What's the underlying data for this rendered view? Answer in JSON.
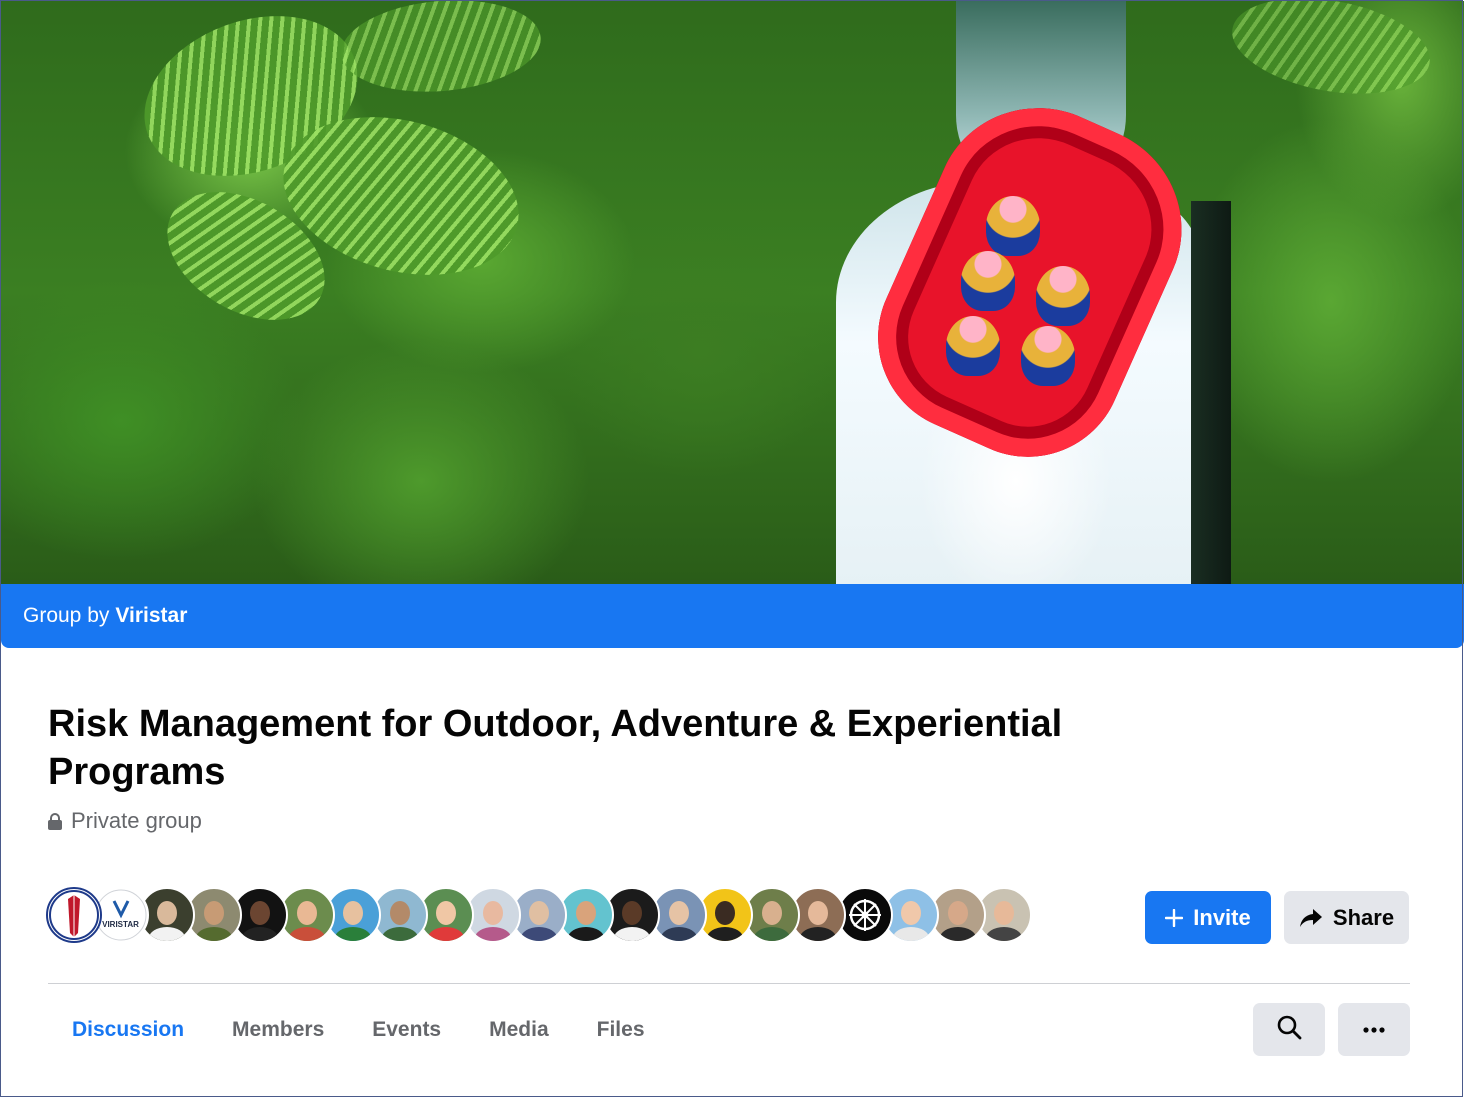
{
  "header": {
    "group_by_prefix": "Group by",
    "group_owner": "Viristar"
  },
  "group": {
    "title": "Risk Management for Outdoor, Adventure & Experiential Programs",
    "privacy": "Private group"
  },
  "members_preview": {
    "avatars": [
      {
        "kind": "logo-kayak",
        "bg": "#ffffff"
      },
      {
        "kind": "logo-viristar",
        "label": "VIRISTAR",
        "bg": "#ffffff"
      },
      {
        "kind": "person",
        "bg": "#3b3f2e",
        "skin": "#d9b99b",
        "shirt": "#f2f2f2"
      },
      {
        "kind": "person",
        "bg": "#8d8a70",
        "skin": "#c79b75",
        "shirt": "#556b2f"
      },
      {
        "kind": "person",
        "bg": "#121212",
        "skin": "#6b4531",
        "shirt": "#222222"
      },
      {
        "kind": "person",
        "bg": "#6c8c4d",
        "skin": "#e9b894",
        "shirt": "#c94f3a"
      },
      {
        "kind": "person",
        "bg": "#4aa0d8",
        "skin": "#e7c19f",
        "shirt": "#2a7f3a"
      },
      {
        "kind": "person",
        "bg": "#8fb8d1",
        "skin": "#b38a69",
        "shirt": "#3c6b3c"
      },
      {
        "kind": "person",
        "bg": "#5b8e52",
        "skin": "#f0c7a5",
        "shirt": "#e03a3a"
      },
      {
        "kind": "person",
        "bg": "#cfd8e2",
        "skin": "#e8b9a0",
        "shirt": "#b55a8b"
      },
      {
        "kind": "person",
        "bg": "#9aaec8",
        "skin": "#e0bfa2",
        "shirt": "#3d4a78"
      },
      {
        "kind": "person",
        "bg": "#63c3cf",
        "skin": "#d9a37b",
        "shirt": "#1a1a1a"
      },
      {
        "kind": "person",
        "bg": "#1b1b1b",
        "skin": "#5a3a27",
        "shirt": "#f2f2f2"
      },
      {
        "kind": "person",
        "bg": "#7a93b5",
        "skin": "#e6c3a5",
        "shirt": "#2e3b55"
      },
      {
        "kind": "person",
        "bg": "#f2c418",
        "skin": "#3a2b22",
        "shirt": "#1f1f1f"
      },
      {
        "kind": "person",
        "bg": "#6e7e4a",
        "skin": "#d8b08e",
        "shirt": "#3d6b3d"
      },
      {
        "kind": "person",
        "bg": "#8d6d55",
        "skin": "#e5b99a",
        "shirt": "#222222"
      },
      {
        "kind": "logo-wheel",
        "bg": "#0a0a0a"
      },
      {
        "kind": "person",
        "bg": "#8ec0e6",
        "skin": "#f0c8aa",
        "shirt": "#e8e8e8"
      },
      {
        "kind": "person",
        "bg": "#b3a089",
        "skin": "#d6a889",
        "shirt": "#2a2a2a"
      },
      {
        "kind": "person",
        "bg": "#c9c2b2",
        "skin": "#e7b999",
        "shirt": "#444444"
      }
    ]
  },
  "actions": {
    "invite_label": "Invite",
    "share_label": "Share"
  },
  "tabs": [
    {
      "label": "Discussion",
      "active": true
    },
    {
      "label": "Members",
      "active": false
    },
    {
      "label": "Events",
      "active": false
    },
    {
      "label": "Media",
      "active": false
    },
    {
      "label": "Files",
      "active": false
    }
  ],
  "toolbar": {
    "search_icon": "search-icon",
    "more_icon": "more-horizontal-icon"
  },
  "colors": {
    "accent": "#1877f2",
    "secondary_button": "#e4e6eb",
    "text_primary": "#050505",
    "text_secondary": "#65676b"
  }
}
